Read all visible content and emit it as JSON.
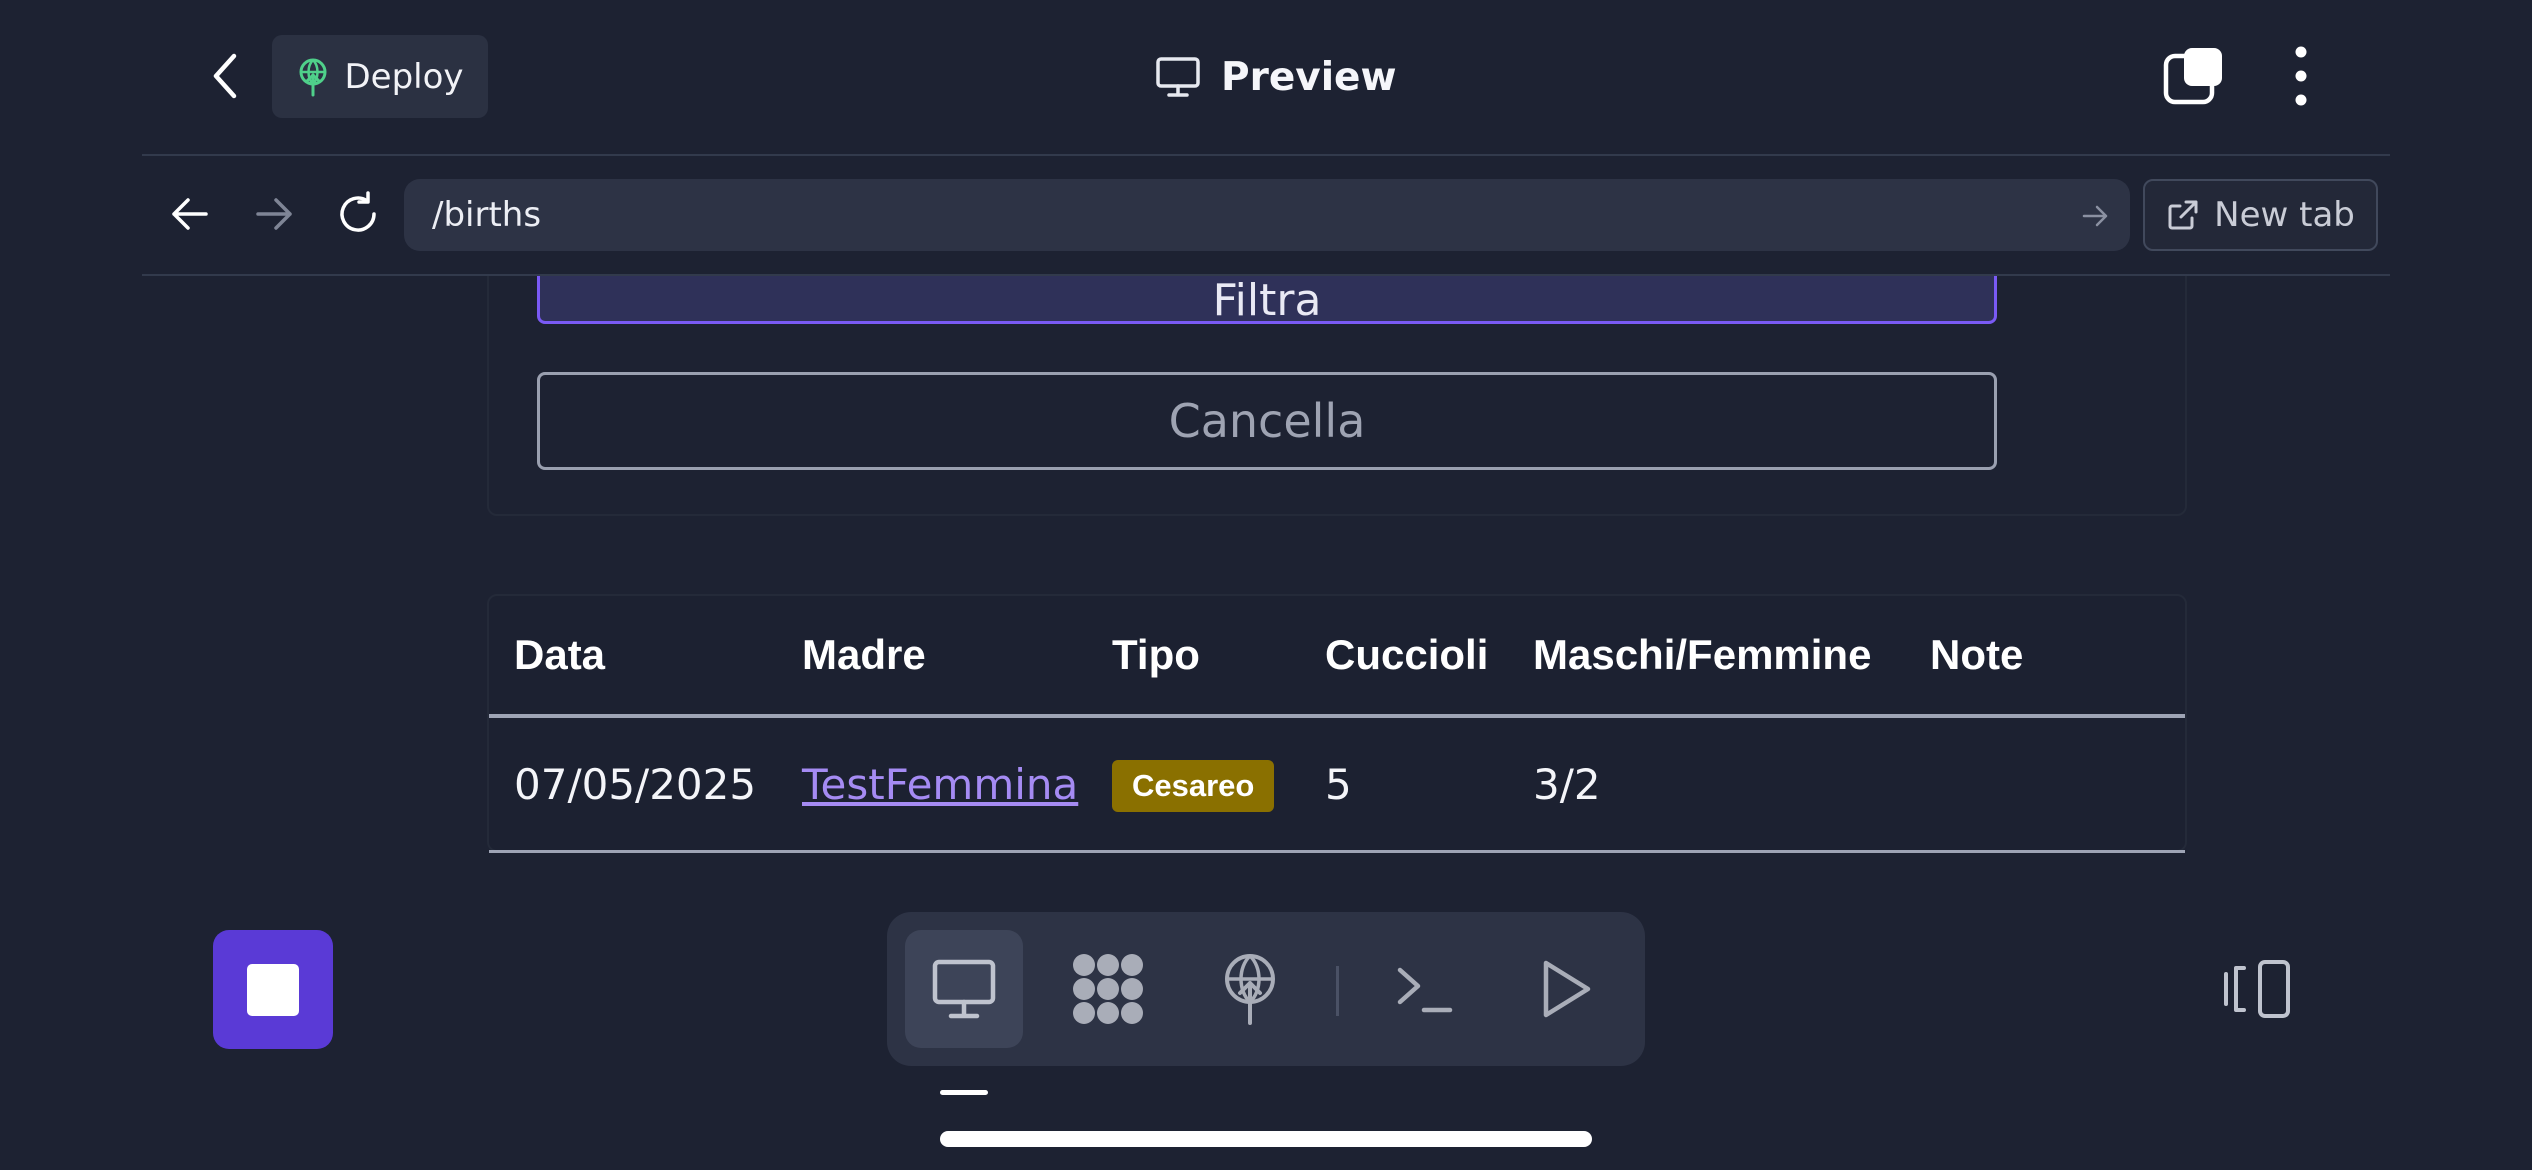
{
  "topbar": {
    "deploy_label": "Deploy",
    "title": "Preview"
  },
  "browser": {
    "url": "/births",
    "new_tab_label": "New tab"
  },
  "filters": {
    "filter_button": "Filtra",
    "clear_button": "Cancella"
  },
  "table": {
    "headers": [
      "Data",
      "Madre",
      "Tipo",
      "Cuccioli",
      "Maschi/Femmine",
      "Note"
    ],
    "rows": [
      {
        "date": "07/05/2025",
        "mother": "TestFemmina",
        "type": "Cesareo",
        "puppies": "5",
        "males_females": "3/2",
        "notes": ""
      }
    ]
  },
  "colors": {
    "background": "#1d2232",
    "accent": "#5a3ad6",
    "badge": "#8a7000",
    "link": "#a58bf3"
  },
  "icons": {
    "back": "chevron-left-icon",
    "deploy": "deploy-globe-icon",
    "preview": "monitor-icon",
    "tabs": "tabs-icon",
    "more": "more-vertical-icon",
    "nav_back": "arrow-left-icon",
    "nav_forward": "arrow-right-icon",
    "reload": "reload-icon",
    "go": "arrow-right-icon",
    "new_tab": "external-link-icon",
    "dock": [
      "monitor-icon",
      "packages-icon",
      "deploy-globe-icon",
      "terminal-icon",
      "play-icon"
    ],
    "device": "device-toggle-icon"
  }
}
